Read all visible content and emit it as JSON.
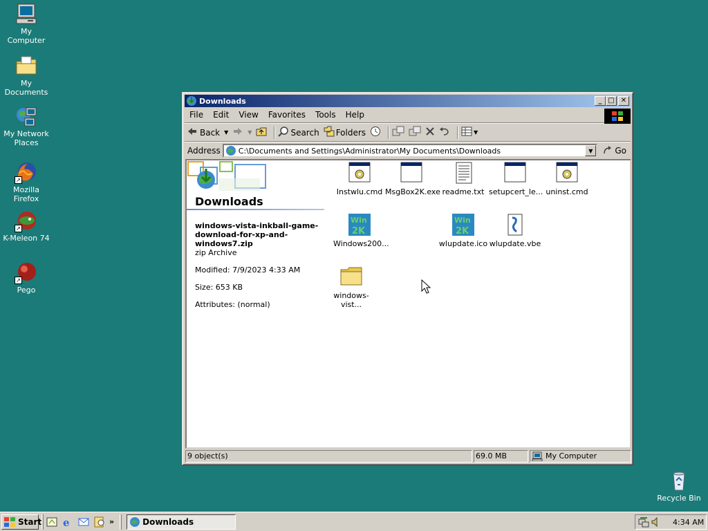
{
  "desktop": {
    "icons": [
      {
        "label": "My Computer",
        "icon": "my-computer-icon"
      },
      {
        "label": "My Documents",
        "icon": "folder-documents-icon"
      },
      {
        "label": "My Network Places",
        "icon": "network-icon"
      },
      {
        "label": "Mozilla Firefox",
        "icon": "firefox-icon"
      },
      {
        "label": "K-Meleon 74",
        "icon": "k-meleon-icon"
      },
      {
        "label": "Pego",
        "icon": "pego-icon"
      }
    ],
    "recycle_bin": "Recycle Bin"
  },
  "window": {
    "title": "Downloads",
    "menu": [
      "File",
      "Edit",
      "View",
      "Favorites",
      "Tools",
      "Help"
    ],
    "toolbar": {
      "back": "Back",
      "search": "Search",
      "folders": "Folders"
    },
    "address": {
      "label": "Address",
      "value": "C:\\Documents and Settings\\Administrator\\My Documents\\Downloads",
      "go": "Go"
    },
    "info_pane": {
      "title": "Downloads",
      "file_name": "windows-vista-inkball-game-download-for-xp-and-windows7.zip",
      "file_type": "zip Archive",
      "modified": "Modified: 7/9/2023 4:33 AM",
      "size": "Size: 653 KB",
      "attributes": "Attributes: (normal)"
    },
    "files": [
      {
        "name": "Instwlu.cmd",
        "icon": "cmd-script-icon"
      },
      {
        "name": "MsgBox2K.exe",
        "icon": "exe-window-icon"
      },
      {
        "name": "readme.txt",
        "icon": "text-file-icon"
      },
      {
        "name": "setupcert_le...",
        "icon": "exe-window-icon"
      },
      {
        "name": "uninst.cmd",
        "icon": "cmd-script-icon"
      },
      {
        "name": "Windows200...",
        "icon": "win2000-icon"
      },
      {
        "name": "wlupdate.ico",
        "icon": "win2000-icon"
      },
      {
        "name": "wlupdate.vbe",
        "icon": "vbe-script-icon"
      },
      {
        "name": "windows-vist...",
        "icon": "folder-icon"
      }
    ],
    "status": {
      "objects": "9 object(s)",
      "size": "69.0 MB",
      "zone": "My Computer"
    }
  },
  "taskbar": {
    "start": "Start",
    "task": "Downloads",
    "clock": "4:34 AM"
  },
  "colors": {
    "desktop": "#1b7b78",
    "title_active": "#0a246a",
    "face": "#d4d0c8"
  }
}
